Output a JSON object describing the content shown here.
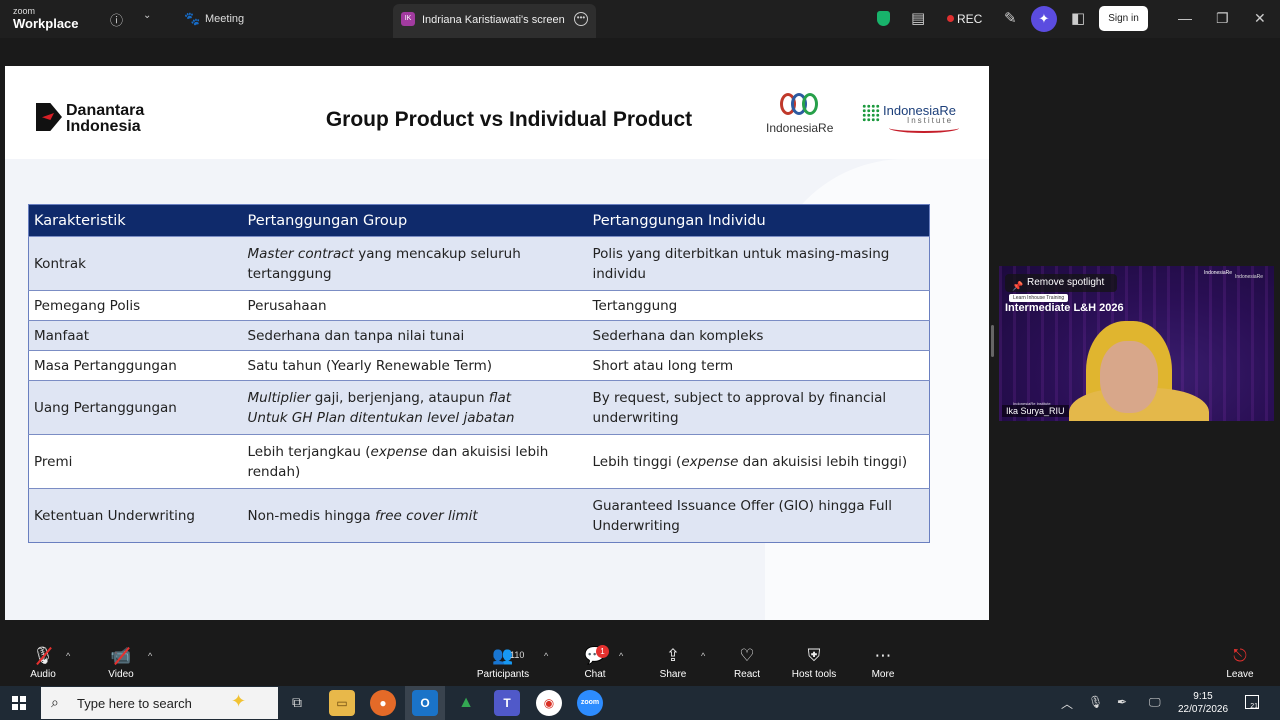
{
  "titlebar": {
    "brand_line1": "zoom",
    "brand_line2": "Workplace",
    "meeting_tab": "Meeting",
    "share_tab_initials": "IK",
    "share_tab_title": "Indriana Karistiawati's screen",
    "rec_label": "REC",
    "signin_label": "Sign in"
  },
  "slide": {
    "logo_left": "Danantara Indonesia",
    "logo_left_line1": "Danantara",
    "logo_left_line2": "Indonesia",
    "title": "Group Product vs Individual Product",
    "logo_mid_name": "IndonesiaRe",
    "logo_right_name": "IndonesiaRe",
    "logo_right_sub": "Institute",
    "table": {
      "headers": [
        "Karakteristik",
        "Pertanggungan Group",
        "Pertanggungan Individu"
      ],
      "rows": [
        {
          "k": "Kontrak",
          "g_em": "Master contract",
          "g": " yang mencakup seluruh tertanggung",
          "i": "Polis yang diterbitkan untuk masing-masing individu"
        },
        {
          "k": "Pemegang Polis",
          "g": "Perusahaan",
          "i": "Tertanggung"
        },
        {
          "k": "Manfaat",
          "g": "Sederhana dan tanpa nilai tunai",
          "i": "Sederhana dan kompleks"
        },
        {
          "k": "Masa Pertanggungan",
          "g": "Satu tahun (Yearly Renewable Term)",
          "i": "Short atau long term"
        },
        {
          "k": "Uang Pertanggungan",
          "g_em": "Multiplier",
          "g": " gaji, berjenjang, ataupun ",
          "g_em2": "flat",
          "g_line2": "Untuk GH Plan ditentukan level jabatan",
          "i": "By request, subject to approval by financial underwriting"
        },
        {
          "k": "Premi",
          "g": "Lebih terjangkau (",
          "g_em": "expense",
          "g_tail": " dan akuisisi lebih rendah)",
          "i": "Lebih tinggi (",
          "i_em": "expense",
          "i_tail": " dan akuisisi lebih tinggi)"
        },
        {
          "k": "Ketentuan Underwriting",
          "g": "Non-medis hingga ",
          "g_em": "free cover limit",
          "i": "Guaranteed Issuance Offer (GIO) hingga Full Underwriting"
        }
      ]
    }
  },
  "video": {
    "spotlight": "Remove spotlight",
    "training_tag": "Learn Inhouse Training",
    "title": "Intermediate L&H 2026",
    "logo1": "IndonesiaRe",
    "logo2": "IndonesiaRe",
    "org": "IndonesiaRe Institute",
    "name": "Ika Surya_RIU"
  },
  "toolbar": {
    "audio": "Audio",
    "video": "Video",
    "participants": "Participants",
    "participants_count": "110",
    "chat": "Chat",
    "chat_badge": "1",
    "share": "Share",
    "react": "React",
    "host_tools": "Host tools",
    "more": "More",
    "leave": "Leave"
  },
  "taskbar": {
    "search_placeholder": "Type here to search",
    "time": "9:15",
    "date": "22/07/2026",
    "notif_count": "21"
  }
}
